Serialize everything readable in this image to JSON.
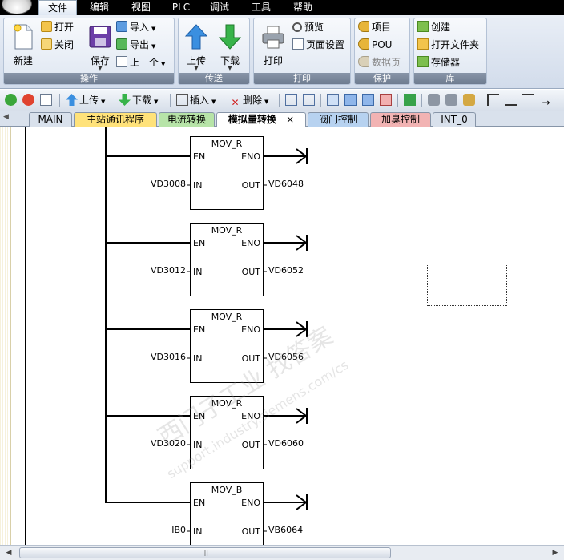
{
  "menu": {
    "items": [
      "文件",
      "编辑",
      "视图",
      "PLC",
      "调试",
      "工具",
      "帮助"
    ],
    "active_index": 0
  },
  "ribbon": {
    "groups": [
      {
        "label": "操作",
        "buttons": {
          "new": "新建",
          "open": "打开",
          "close": "关闭",
          "save": "保存",
          "import": "导入",
          "export": "导出",
          "previous": "上一个"
        }
      },
      {
        "label": "传送",
        "buttons": {
          "upload": "上传",
          "download": "下载"
        }
      },
      {
        "label": "打印",
        "buttons": {
          "print": "打印",
          "preview": "预览",
          "page_setup": "页面设置"
        }
      },
      {
        "label": "保护",
        "buttons": {
          "project": "项目",
          "pou": "POU",
          "data_page": "数据页"
        }
      },
      {
        "label": "库",
        "buttons": {
          "create": "创建",
          "open_folder": "打开文件夹",
          "memory": "存储器"
        }
      }
    ]
  },
  "toolbar": {
    "upload": "上传",
    "download": "下载",
    "insert": "插入",
    "delete": "删除"
  },
  "tabs": [
    {
      "label": "MAIN",
      "color": "#d9e1ec"
    },
    {
      "label": "主站通讯程序",
      "color": "#ffe27a"
    },
    {
      "label": "电流转换",
      "color": "#b7e4a8"
    },
    {
      "label": "模拟量转换",
      "color": "#ffffff",
      "active": true,
      "close": "×"
    },
    {
      "label": "阀门控制",
      "color": "#b7d2f0"
    },
    {
      "label": "加臭控制",
      "color": "#f2b3b3"
    },
    {
      "label": "INT_0",
      "color": "#d9e1ec"
    }
  ],
  "blocks": [
    {
      "name": "MOV_R",
      "en": "EN",
      "eno": "ENO",
      "in_label": "IN",
      "out_label": "OUT",
      "in_operand": "VD3008",
      "out_operand": "VD6048"
    },
    {
      "name": "MOV_R",
      "en": "EN",
      "eno": "ENO",
      "in_label": "IN",
      "out_label": "OUT",
      "in_operand": "VD3012",
      "out_operand": "VD6052"
    },
    {
      "name": "MOV_R",
      "en": "EN",
      "eno": "ENO",
      "in_label": "IN",
      "out_label": "OUT",
      "in_operand": "VD3016",
      "out_operand": "VD6056"
    },
    {
      "name": "MOV_R",
      "en": "EN",
      "eno": "ENO",
      "in_label": "IN",
      "out_label": "OUT",
      "in_operand": "VD3020",
      "out_operand": "VD6060"
    },
    {
      "name": "MOV_B",
      "en": "EN",
      "eno": "ENO",
      "in_label": "IN",
      "out_label": "OUT",
      "in_operand": "IB0",
      "out_operand": "VB6064"
    }
  ],
  "watermark": {
    "line1": "西门子工业  找答案",
    "line2": "support.industry.siemens.com/cs"
  },
  "scrollbar": {
    "grip": "|||"
  }
}
